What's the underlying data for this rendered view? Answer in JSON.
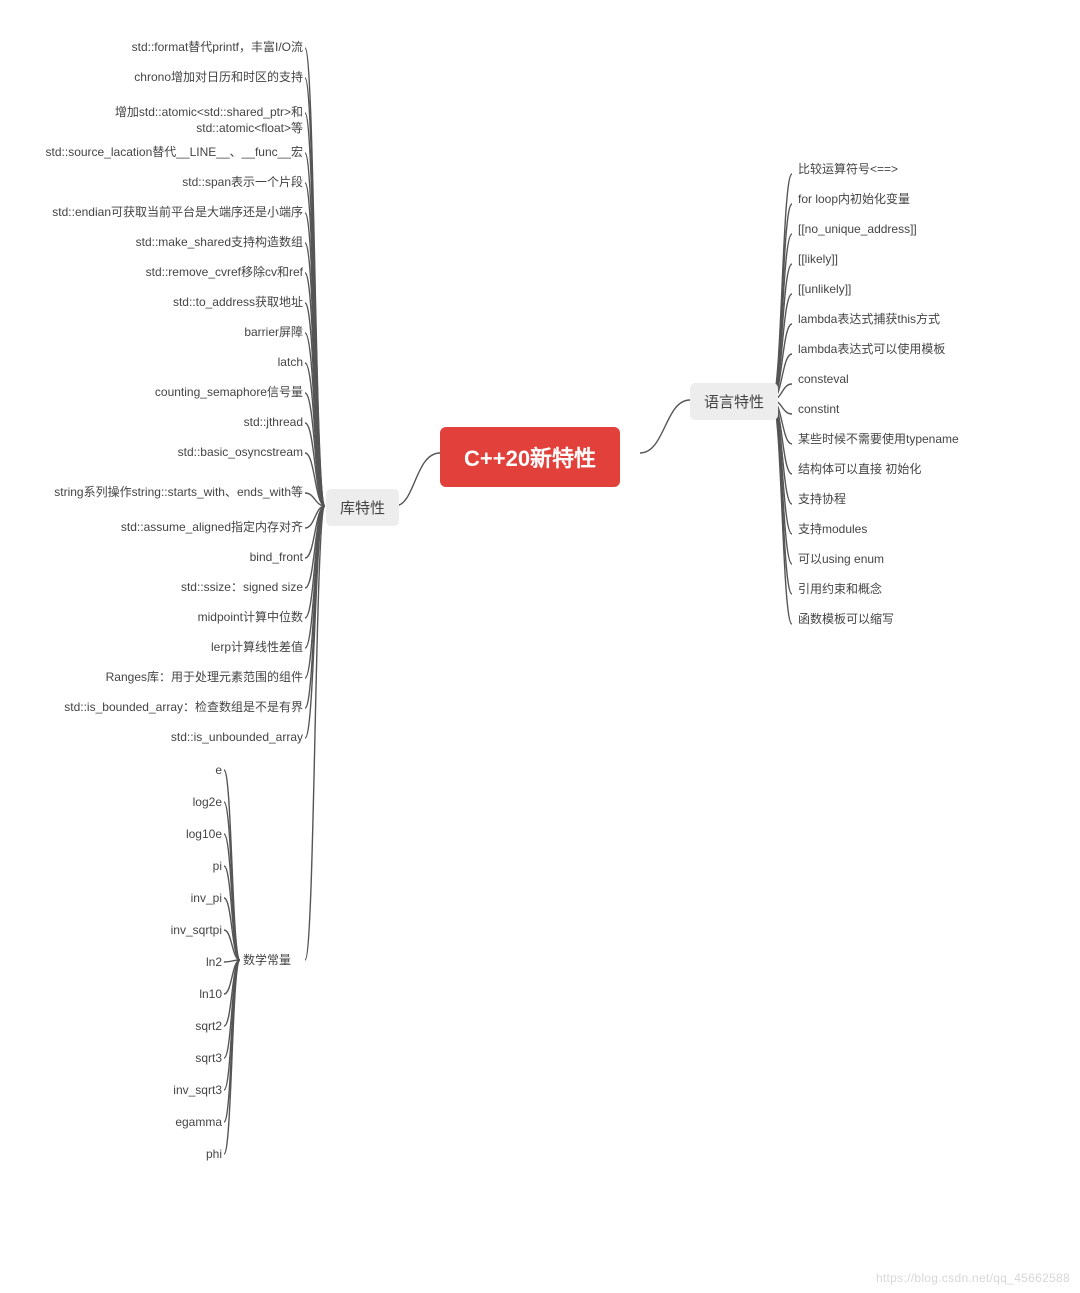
{
  "root": {
    "label": "C++20新特性"
  },
  "branches": {
    "right": {
      "label": "语言特性"
    },
    "left": {
      "label": "库特性"
    },
    "math": {
      "label": "数学常量"
    }
  },
  "right_items": [
    "比较运算符号<==>",
    "for loop内初始化变量",
    "[[no_unique_address]]",
    "[[likely]]",
    "[[unlikely]]",
    "lambda表达式捕获this方式",
    "lambda表达式可以使用模板",
    "consteval",
    "constint",
    "某些时候不需要使用typename",
    "结构体可以直接 初始化",
    "支持协程",
    "支持modules",
    "可以using enum",
    "引用约束和概念",
    "函数模板可以缩写"
  ],
  "left_items": [
    "std::format替代printf，丰富I/O流",
    "chrono增加对日历和时区的支持",
    "增加std::atomic<std::shared_ptr>和std::atomic<float>等",
    "std::source_lacation替代__LINE__、__func__宏",
    "std::span表示一个片段",
    "std::endian可获取当前平台是大端序还是小端序",
    "std::make_shared支持构造数组",
    "std::remove_cvref移除cv和ref",
    "std::to_address获取地址",
    "barrier屏障",
    "latch",
    "counting_semaphore信号量",
    "std::jthread",
    "std::basic_osyncstream",
    "string系列操作string::starts_with、ends_with等",
    "std::assume_aligned指定内存对齐",
    "bind_front",
    "std::ssize：signed size",
    "midpoint计算中位数",
    "lerp计算线性差值",
    "Ranges库：用于处理元素范围的组件",
    "std::is_bounded_array：检查数组是不是有界",
    "std::is_unbounded_array"
  ],
  "math_items": [
    "e",
    "log2e",
    "log10e",
    "pi",
    "inv_pi",
    "inv_sqrtpi",
    "ln2",
    "ln10",
    "sqrt2",
    "sqrt3",
    "inv_sqrt3",
    "egamma",
    "phi"
  ],
  "watermark": "https://blog.csdn.net/qq_45662588"
}
